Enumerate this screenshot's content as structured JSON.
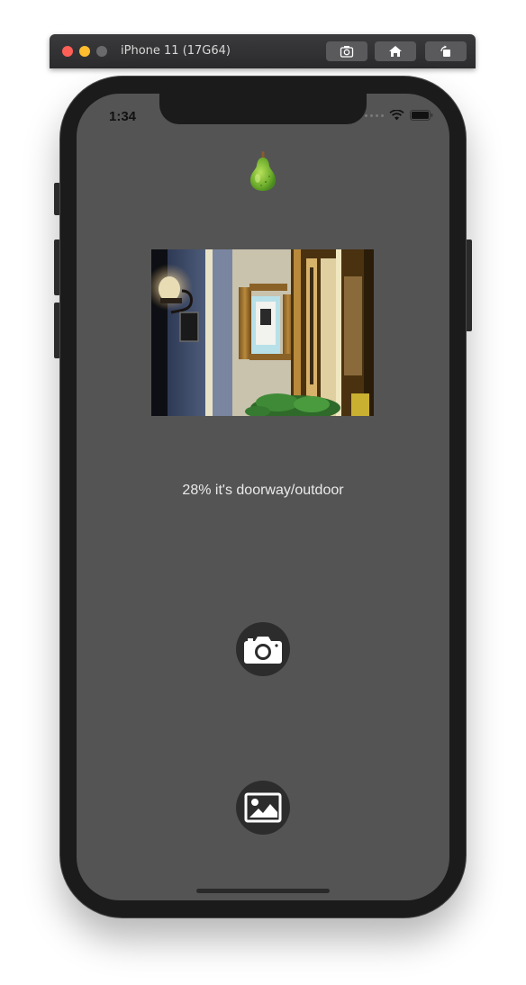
{
  "window": {
    "title": "iPhone 11 (17G64)",
    "buttons": [
      {
        "icon": "screenshot-icon"
      },
      {
        "icon": "home-icon"
      },
      {
        "icon": "rotate-icon"
      }
    ]
  },
  "status_bar": {
    "time": "1:34",
    "icons": [
      "signal-dots-icon",
      "wifi-icon",
      "battery-icon"
    ]
  },
  "app": {
    "logo_icon": "pear-icon",
    "result_text": "28% it's doorway/outdoor",
    "buttons": [
      {
        "name": "camera-button",
        "icon": "camera-icon"
      },
      {
        "name": "photo-library-button",
        "icon": "image-icon"
      }
    ]
  },
  "colors": {
    "screen_background": "#545454",
    "button_background": "#2c2c2c",
    "result_text": "#eaeaea"
  }
}
